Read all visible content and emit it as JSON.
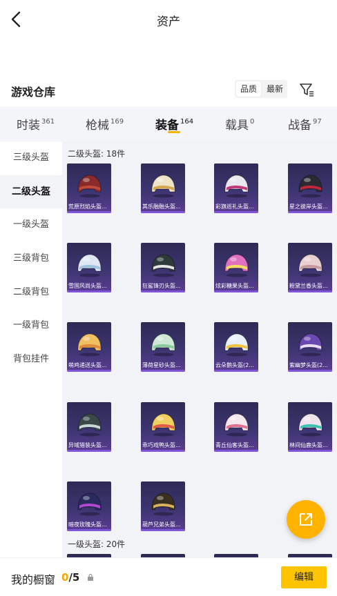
{
  "header": {
    "title": "资产",
    "back_icon": "chevron-left-icon"
  },
  "section": {
    "title": "游戏仓库",
    "sort_options": [
      "品质",
      "最新"
    ],
    "sort_selected": "品质",
    "filter_icon": "filter-icon"
  },
  "tabs": [
    {
      "label": "时装",
      "count": "361"
    },
    {
      "label": "枪械",
      "count": "169"
    },
    {
      "label": "装备",
      "count": "164",
      "active": true
    },
    {
      "label": "载具",
      "count": "0"
    },
    {
      "label": "战备",
      "count": "97"
    }
  ],
  "sidebar": [
    {
      "label": "三级头盔"
    },
    {
      "label": "二级头盔",
      "active": true
    },
    {
      "label": "一级头盔"
    },
    {
      "label": "三级背包"
    },
    {
      "label": "二级背包"
    },
    {
      "label": "一级背包"
    },
    {
      "label": "背包挂件"
    }
  ],
  "groups": [
    {
      "label": "二级头盔: 18件"
    },
    {
      "label": "一级头盔: 20件"
    }
  ],
  "items": [
    {
      "name": "荒原烈焰头盔...",
      "color": "#8a2a2a",
      "accent": "#c14b3a"
    },
    {
      "name": "其乐融融头盔...",
      "color": "#efe4c8",
      "accent": "#d4a850"
    },
    {
      "name": "彩旗巡礼头盔...",
      "color": "#e8e8ee",
      "accent": "#c33a7a"
    },
    {
      "name": "星之彼岸头盔...",
      "color": "#2a2a33",
      "accent": "#c0283a"
    },
    {
      "name": "雪国风尚头盔...",
      "color": "#dfe8f2",
      "accent": "#9ec2e0"
    },
    {
      "name": "狂鲨锋刃头盔...",
      "color": "#2f3a3a",
      "accent": "#e5e5e5"
    },
    {
      "name": "炫彩糖果头盔...",
      "color": "#e070c0",
      "accent": "#f3e060"
    },
    {
      "name": "粉黛兰香头盔...",
      "color": "#e8d0d0",
      "accent": "#c79aa2"
    },
    {
      "name": "萌鸡递送头盔...",
      "color": "#f0c060",
      "accent": "#e08a40"
    },
    {
      "name": "薄荷星砂头盔...",
      "color": "#cfe8d6",
      "accent": "#8ccaa0"
    },
    {
      "name": "云朵鹅头盔(2...",
      "color": "#e8f0f8",
      "accent": "#f2c340"
    },
    {
      "name": "紫幽梦头盔(2...",
      "color": "#6a4ab0",
      "accent": "#e8e0f0"
    },
    {
      "name": "异域猎装头盔...",
      "color": "#3a4848",
      "accent": "#c8d8d8"
    },
    {
      "name": "乖巧戏鸭头盔...",
      "color": "#f0d060",
      "accent": "#e65a4a"
    },
    {
      "name": "青丘仙客头盔...",
      "color": "#f4e8ee",
      "accent": "#e07090"
    },
    {
      "name": "林间仙鹿头盔...",
      "color": "#f0e4ec",
      "accent": "#3ac4b4"
    },
    {
      "name": "暗夜玫瑰头盔...",
      "color": "#2a2a60",
      "accent": "#b04ad0"
    },
    {
      "name": "葫芦兄弟头盔...",
      "color": "#3a3020",
      "accent": "#d8b060"
    }
  ],
  "bottom": {
    "showcase_label": "我的橱窗",
    "used": "0",
    "separator": "/",
    "total": "5",
    "lock_icon": "lock-icon",
    "edit_label": "编辑"
  },
  "fab": {
    "icon": "share-out-icon"
  }
}
